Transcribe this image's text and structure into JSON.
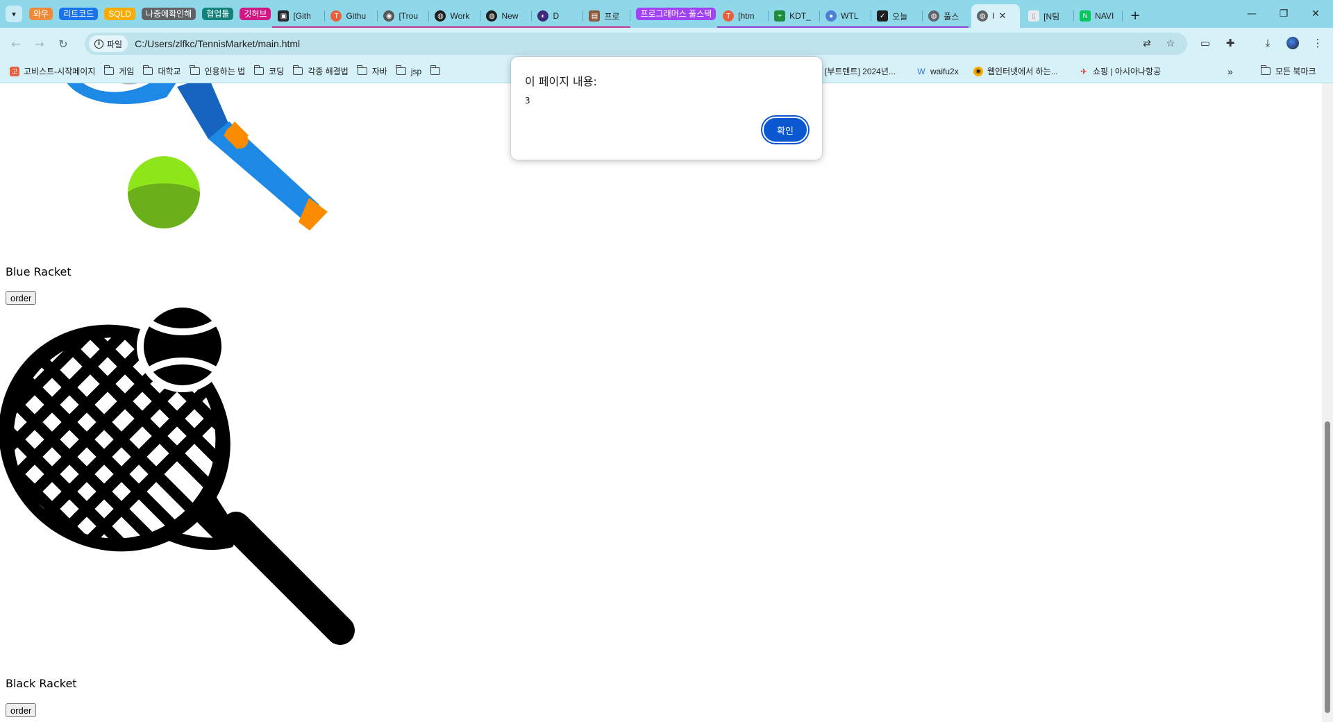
{
  "tab_groups": [
    {
      "label": "와우",
      "color": "#f08a38"
    },
    {
      "label": "리트코드",
      "color": "#1a73e8"
    },
    {
      "label": "SQLD",
      "color": "#f9ab00"
    },
    {
      "label": "나중에확인해",
      "color": "#5f6368"
    },
    {
      "label": "협업툴",
      "color": "#13827a"
    },
    {
      "label": "깃허브",
      "color": "#d01884"
    }
  ],
  "tabs": [
    {
      "label": "[Gith",
      "fav_color": "#24292f",
      "fav_char": "▣"
    },
    {
      "label": "Githu",
      "fav_color": "#e8603c",
      "fav_char": "T"
    },
    {
      "label": "[Trou",
      "fav_color": "#555555",
      "fav_char": "◉"
    },
    {
      "label": "Work",
      "fav_color": "#1f1f1f",
      "fav_char": "◍"
    },
    {
      "label": "New",
      "fav_color": "#1f1f1f",
      "fav_char": "◍"
    },
    {
      "label": "D",
      "fav_color": "#3b2a7a",
      "fav_char": "◐"
    },
    {
      "label": "프로",
      "fav_color": "#8a5a3c",
      "fav_char": "▤"
    },
    {
      "label": "[htm",
      "fav_color": "#e8603c",
      "fav_char": "T"
    },
    {
      "label": "KDT_",
      "fav_color": "#1e8e3e",
      "fav_char": "+"
    },
    {
      "label": "WTL",
      "fav_color": "#4a7fd4",
      "fav_char": "●"
    },
    {
      "label": "오늘",
      "fav_color": "#1f1f1f",
      "fav_char": "✓"
    },
    {
      "label": "풀스",
      "fav_color": "#5f6368",
      "fav_char": "◍"
    },
    {
      "label": "I",
      "fav_color": "#5f6368",
      "fav_char": "◍"
    },
    {
      "label": "[N팀",
      "fav_color": "#9aa0a6",
      "fav_char": "▯"
    },
    {
      "label": "NAVI",
      "fav_color": "#03c75a",
      "fav_char": "N"
    }
  ],
  "purple_group": {
    "label": "프로그래머스 풀스택",
    "color": "#a142f4"
  },
  "address": {
    "chip": "파일",
    "url": "C:/Users/zlfkc/TennisMarket/main.html"
  },
  "bookmarks": [
    {
      "label": "고비스트-시작페이지",
      "type": "site",
      "fav_color": "#e8603c",
      "fav_char": "고"
    },
    {
      "label": "게임",
      "type": "folder"
    },
    {
      "label": "대학교",
      "type": "folder"
    },
    {
      "label": "인용하는 법",
      "type": "folder"
    },
    {
      "label": "코딩",
      "type": "folder"
    },
    {
      "label": "각종 해결법",
      "type": "folder"
    },
    {
      "label": "자바",
      "type": "folder"
    },
    {
      "label": "jsp",
      "type": "folder"
    }
  ],
  "bookmarks_right": [
    {
      "label": "[부트텐트] 2024년...",
      "fav_color": "",
      "fav_char": ""
    },
    {
      "label": "waifu2x",
      "fav_color": "#3a6fd8",
      "fav_char": "W"
    },
    {
      "label": "웹인터넷에서 하는...",
      "fav_color": "#f9ab00",
      "fav_char": "◉"
    },
    {
      "label": "쇼핑 | 아시아나항공",
      "fav_color": "#d93025",
      "fav_char": "✈"
    }
  ],
  "all_bookmarks": "모든 북마크",
  "products": [
    {
      "name": "Blue Racket",
      "button": "order"
    },
    {
      "name": "Black Racket",
      "button": "order"
    }
  ],
  "alert": {
    "title": "이 페이지 내용:",
    "message": "3",
    "ok": "확인"
  }
}
